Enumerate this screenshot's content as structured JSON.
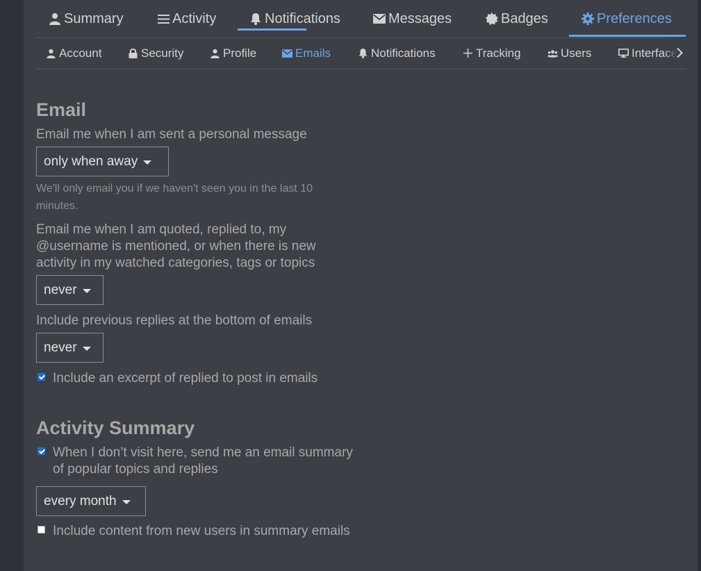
{
  "primary_nav": {
    "items": [
      {
        "label": "Summary",
        "icon": "user-icon"
      },
      {
        "label": "Activity",
        "icon": "list-icon"
      },
      {
        "label": "Notifications",
        "icon": "bell-icon"
      },
      {
        "label": "Messages",
        "icon": "envelope-icon"
      },
      {
        "label": "Badges",
        "icon": "badge-icon"
      },
      {
        "label": "Preferences",
        "icon": "gear-icon",
        "active": true
      }
    ]
  },
  "secondary_nav": {
    "items": [
      {
        "label": "Account",
        "icon": "user-icon"
      },
      {
        "label": "Security",
        "icon": "lock-icon"
      },
      {
        "label": "Profile",
        "icon": "user-icon"
      },
      {
        "label": "Emails",
        "icon": "envelope-icon",
        "active": true
      },
      {
        "label": "Notifications",
        "icon": "bell-icon"
      },
      {
        "label": "Tracking",
        "icon": "plus-icon"
      },
      {
        "label": "Users",
        "icon": "users-icon"
      },
      {
        "label": "Interface",
        "icon": "desktop-icon"
      }
    ],
    "scroll_icon": "chevron-right-icon"
  },
  "email": {
    "heading": "Email",
    "personal_message_label": "Email me when I am sent a personal message",
    "personal_message_value": "only when away",
    "personal_message_help": "We'll only email you if we haven't seen you in the last 10 minutes.",
    "mentions_label": "Email me when I am quoted, replied to, my @username is mentioned, or when there is new activity in my watched categories, tags or topics",
    "mentions_value": "never",
    "previous_replies_label": "Include previous replies at the bottom of emails",
    "previous_replies_value": "never",
    "excerpt_label": "Include an excerpt of replied to post in emails",
    "excerpt_checked": true
  },
  "activity_summary": {
    "heading": "Activity Summary",
    "digest_label": "When I don’t visit here, send me an email summary of popular topics and replies",
    "digest_checked": true,
    "digest_frequency_value": "every month",
    "new_users_label": "Include content from new users in summary emails",
    "new_users_checked": false
  },
  "colors": {
    "accent": "#6aa7e8",
    "background": "#3c3f46",
    "checkbox_checked": "#1b6fd4"
  }
}
